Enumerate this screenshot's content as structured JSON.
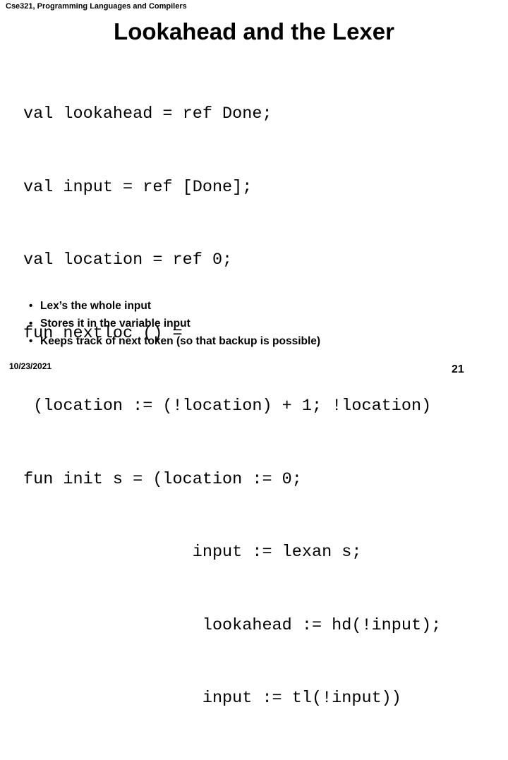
{
  "header": {
    "course_line": "Cse321, Programming Languages and Compilers"
  },
  "title": "Lookahead and the Lexer",
  "code": {
    "lines": [
      "val lookahead = ref Done;",
      "val input = ref [Done];",
      "val location = ref 0;",
      "fun nextloc () =",
      " (location := (!location) + 1; !location)",
      "fun init s = (location := 0;",
      "                 input := lexan s;",
      "                  lookahead := hd(!input);",
      "                  input := tl(!input))"
    ]
  },
  "bullets": {
    "marker": "•",
    "items": [
      "Lex’s the whole input",
      "Stores it in the variable input",
      "Keeps track of next token (so that backup is possible)"
    ]
  },
  "footer": {
    "date": "10/23/2021",
    "page_number": "21"
  },
  "colors": {
    "background": "#ffffff",
    "text": "#000000"
  }
}
